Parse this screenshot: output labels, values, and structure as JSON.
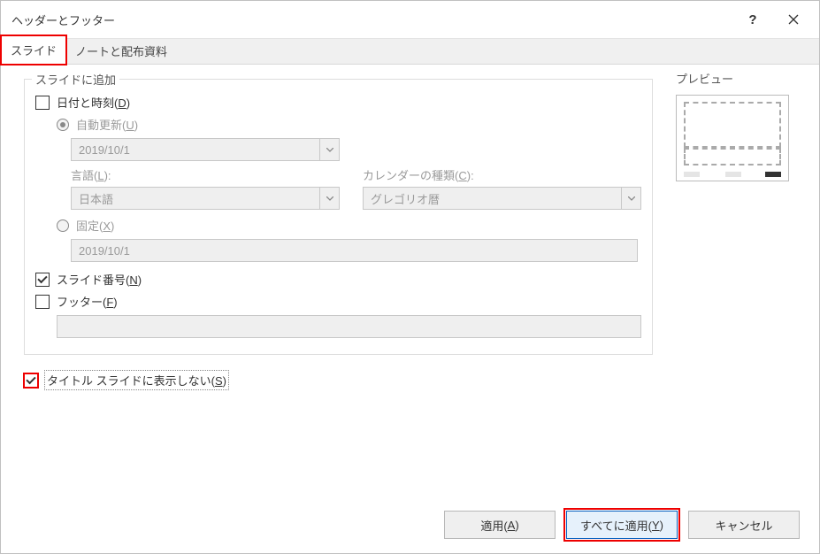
{
  "window": {
    "title": "ヘッダーとフッター",
    "help_label": "?",
    "close_label": "×"
  },
  "tabs": {
    "slide": "スライド",
    "notes": "ノートと配布資料"
  },
  "group": {
    "title": "スライドに追加",
    "datetime_label": "日付と時刻(",
    "datetime_accel": "D",
    "datetime_label_end": ")",
    "auto_label": "自動更新(",
    "auto_accel": "U",
    "auto_label_end": ")",
    "date_value": "2019/10/1",
    "language_label": "言語(",
    "language_accel": "L",
    "language_label_end": "):",
    "language_value": "日本語",
    "calendar_label": "カレンダーの種類(",
    "calendar_accel": "C",
    "calendar_label_end": "):",
    "calendar_value": "グレゴリオ暦",
    "fixed_label": "固定(",
    "fixed_accel": "X",
    "fixed_label_end": ")",
    "fixed_value": "2019/10/1",
    "slidenum_label": "スライド番号(",
    "slidenum_accel": "N",
    "slidenum_label_end": ")",
    "footer_label": "フッター(",
    "footer_accel": "F",
    "footer_label_end": ")",
    "footer_value": ""
  },
  "notitle": {
    "label": "タイトル スライドに表示しない(",
    "accel": "S",
    "label_end": ")"
  },
  "preview": {
    "title": "プレビュー"
  },
  "buttons": {
    "apply": "適用(",
    "apply_accel": "A",
    "apply_end": ")",
    "apply_all": "すべてに適用(",
    "apply_all_accel": "Y",
    "apply_all_end": ")",
    "cancel": "キャンセル"
  }
}
